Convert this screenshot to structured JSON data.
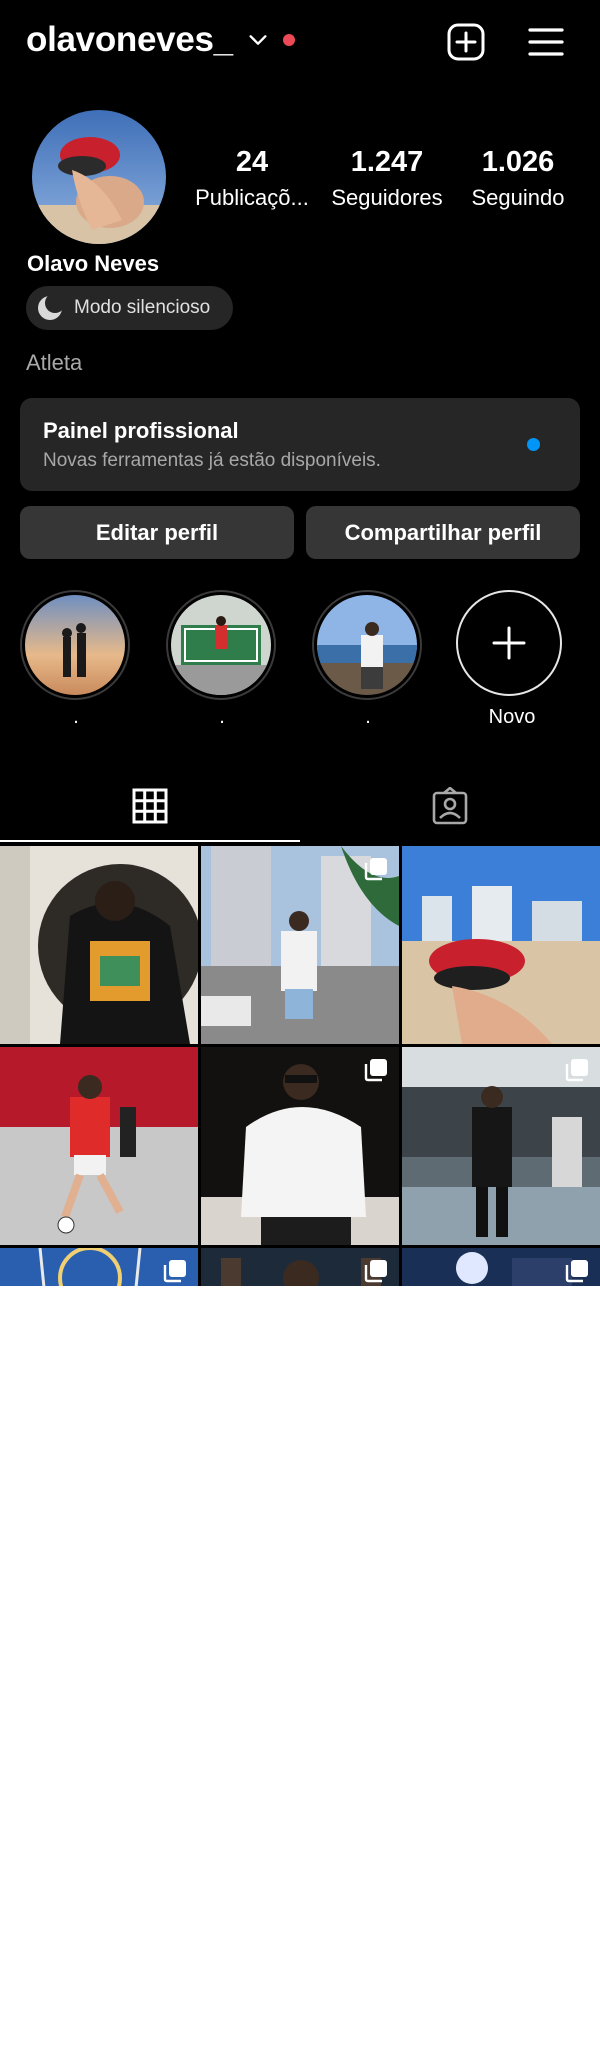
{
  "header": {
    "username": "olavoneves_",
    "icons": [
      "chevron-down-icon",
      "add-post-icon",
      "menu-icon"
    ],
    "notification_color": "#ed4956"
  },
  "profile": {
    "full_name": "Olavo Neves",
    "quiet_mode_label": "Modo silencioso",
    "category": "Atleta",
    "stats": [
      {
        "value": "24",
        "label": "Publicaçõ..."
      },
      {
        "value": "1.247",
        "label": "Seguidores"
      },
      {
        "value": "1.026",
        "label": "Seguindo"
      }
    ]
  },
  "pro_panel": {
    "title": "Painel profissional",
    "subtitle": "Novas ferramentas já estão disponíveis.",
    "dot_color": "#0095f6"
  },
  "actions": {
    "edit_label": "Editar perfil",
    "share_label": "Compartilhar perfil"
  },
  "highlights": [
    {
      "label": "."
    },
    {
      "label": "."
    },
    {
      "label": "."
    },
    {
      "label": "Novo"
    }
  ],
  "tabs": [
    "grid-icon",
    "tagged-icon"
  ],
  "grid": {
    "posts": [
      {
        "alt": "photo",
        "multi": false
      },
      {
        "alt": "photo",
        "multi": true
      },
      {
        "alt": "photo",
        "multi": false
      },
      {
        "alt": "photo",
        "multi": false
      },
      {
        "alt": "photo",
        "multi": true
      },
      {
        "alt": "photo",
        "multi": true
      },
      {
        "alt": "photo",
        "multi": true
      },
      {
        "alt": "photo",
        "multi": true
      },
      {
        "alt": "photo",
        "multi": true
      }
    ]
  },
  "colors": {
    "background": "#000000",
    "surface": "#262626",
    "button": "#363636",
    "text": "#ffffff",
    "muted": "#a8a8a8"
  }
}
